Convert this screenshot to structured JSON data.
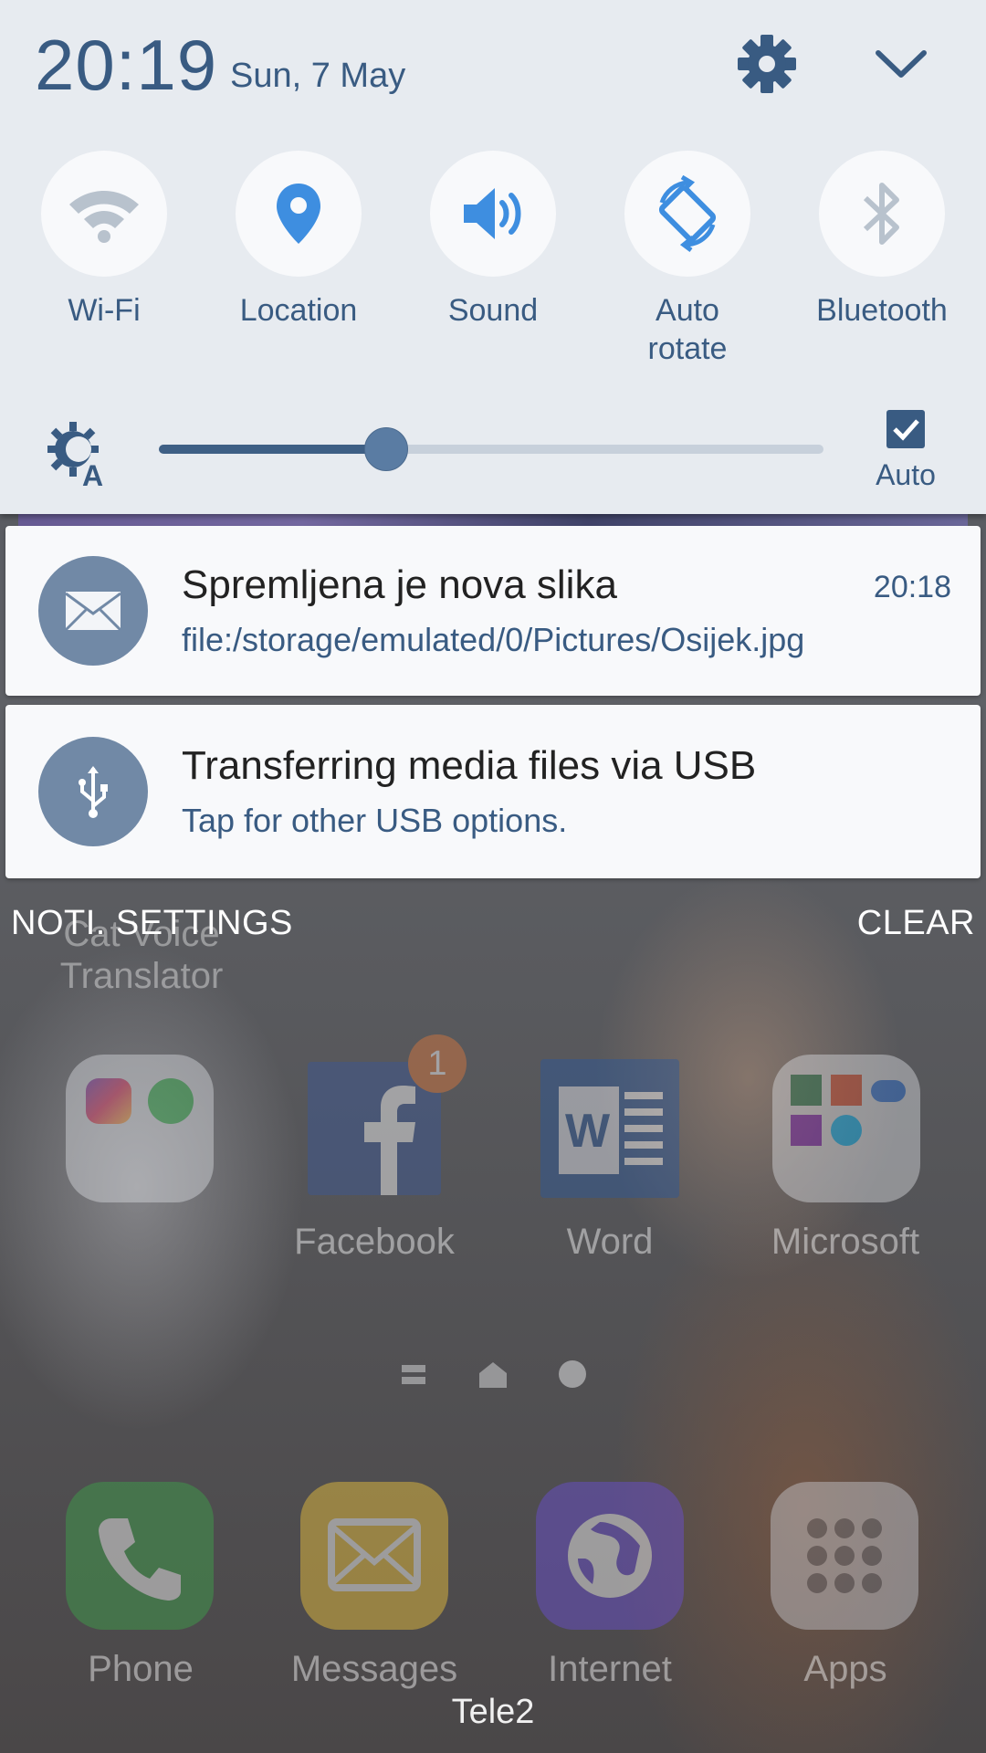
{
  "status": {
    "time": "20:19",
    "date": "Sun, 7 May"
  },
  "quick_toggles": [
    {
      "label": "Wi-Fi",
      "icon": "wifi-icon",
      "active": false
    },
    {
      "label": "Location",
      "icon": "location-pin-icon",
      "active": true
    },
    {
      "label": "Sound",
      "icon": "speaker-icon",
      "active": true
    },
    {
      "label_line1": "Auto",
      "label_line2": "rotate",
      "icon": "auto-rotate-icon",
      "active": true
    },
    {
      "label": "Bluetooth",
      "icon": "bluetooth-icon",
      "active": false
    }
  ],
  "brightness": {
    "level_percent": 34,
    "auto_checked": true,
    "auto_label": "Auto"
  },
  "notifications": [
    {
      "icon": "mail-icon",
      "title": "Spremljena je nova slika",
      "body": "file:/storage/emulated/0/Pictures/Osijek.jpg",
      "time": "20:18"
    },
    {
      "icon": "usb-icon",
      "title": "Transferring media files via USB",
      "body": "Tap for other USB options."
    }
  ],
  "panel_actions": {
    "settings_label": "NOTI. SETTINGS",
    "clear_label": "CLEAR"
  },
  "home_screen": {
    "widget_text_line1": "Cat Voice",
    "widget_text_line2": "Translator",
    "apps": [
      {
        "label": "",
        "icon": "social-folder-icon"
      },
      {
        "label": "Facebook",
        "icon": "facebook-icon",
        "badge": "1"
      },
      {
        "label": "Word",
        "icon": "word-icon"
      },
      {
        "label": "Microsoft",
        "icon": "microsoft-folder-icon"
      }
    ],
    "dock": [
      {
        "label": "Phone",
        "icon": "phone-icon"
      },
      {
        "label": "Messages",
        "icon": "messages-icon"
      },
      {
        "label": "Internet",
        "icon": "internet-icon"
      },
      {
        "label": "Apps",
        "icon": "apps-grid-icon"
      }
    ],
    "carrier": "Tele2"
  },
  "colors": {
    "accent": "#395b82",
    "panel_bg": "#e7ebf0",
    "notif_icon_bg": "#7189a6"
  }
}
